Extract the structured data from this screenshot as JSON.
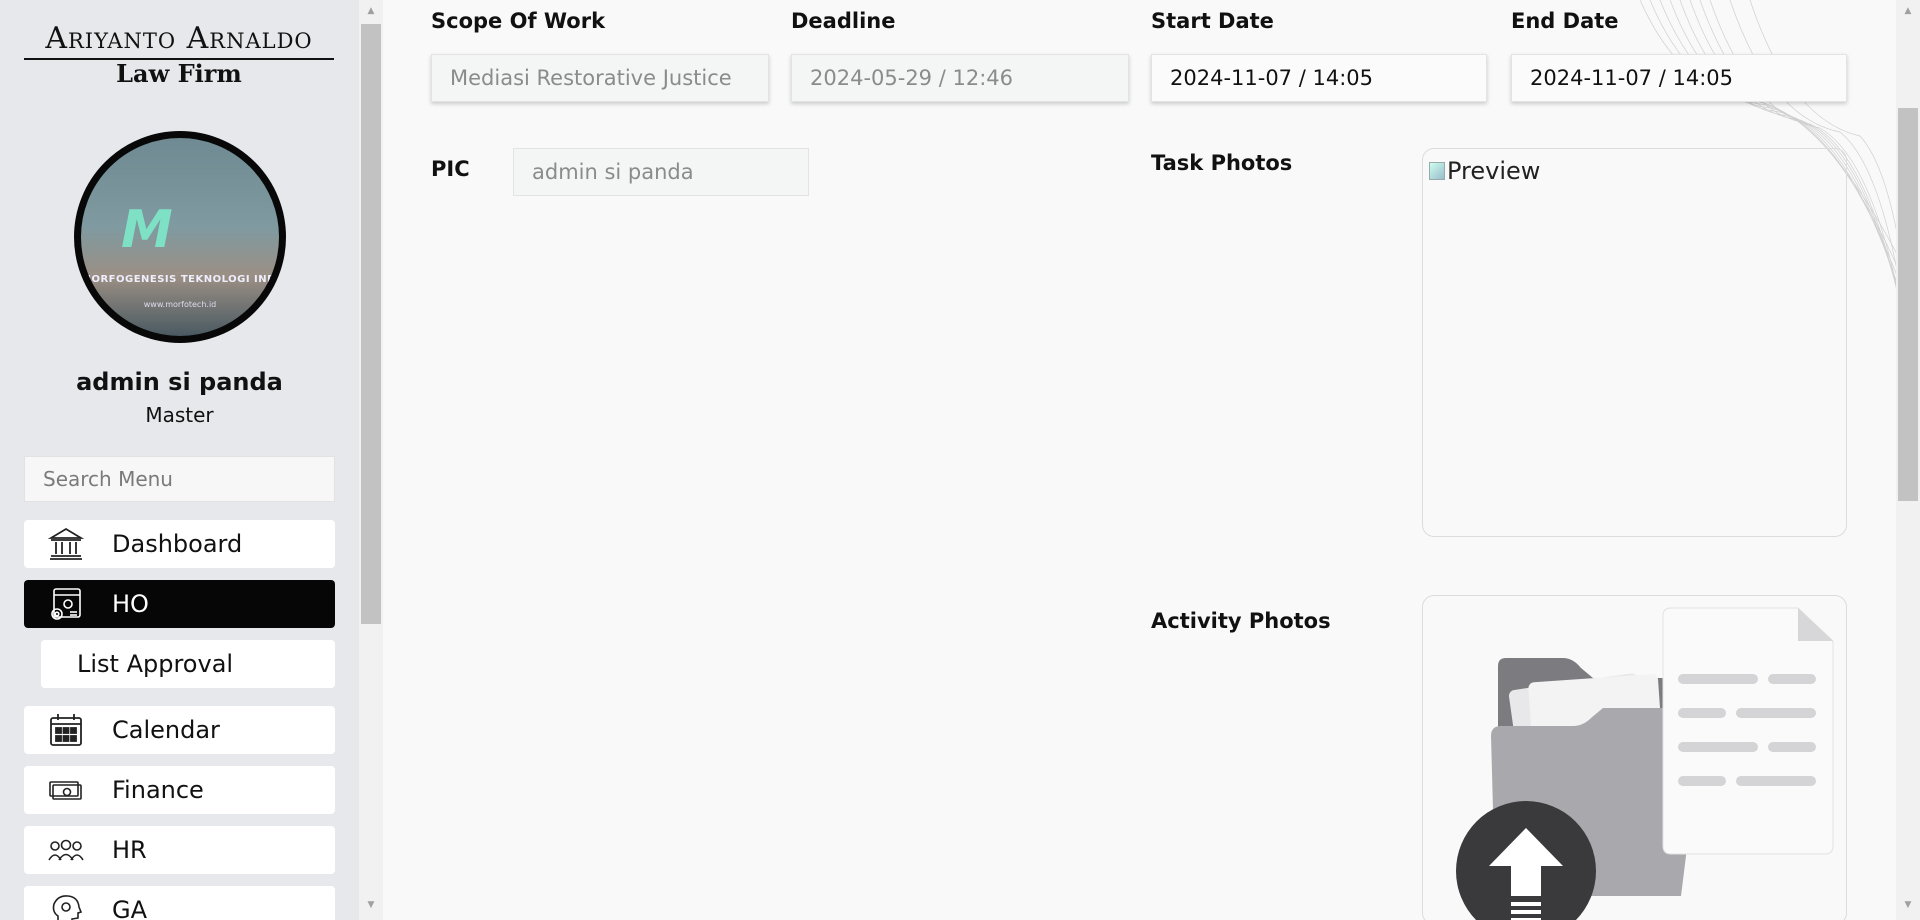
{
  "logo": {
    "name": "Ariyanto Arnaldo",
    "sub": "Law Firm"
  },
  "avatar": {
    "corp_text": "MORFOGENESIS TEKNOLOGI INDO",
    "url_text": "www.morfotech.id"
  },
  "user": {
    "name": "admin si panda",
    "role": "Master"
  },
  "search": {
    "placeholder": "Search Menu"
  },
  "menu": {
    "dashboard": "Dashboard",
    "ho": "HO",
    "list_approval": "List Approval",
    "calendar": "Calendar",
    "finance": "Finance",
    "hr": "HR",
    "ga": "GA"
  },
  "form": {
    "scope_of_work": {
      "label": "Scope Of Work",
      "value": "Mediasi Restorative Justice"
    },
    "deadline": {
      "label": "Deadline",
      "value": "2024-05-29 / 12:46"
    },
    "start_date": {
      "label": "Start Date",
      "value": "2024-11-07 / 14:05"
    },
    "end_date": {
      "label": "End Date",
      "value": "2024-11-07 / 14:05"
    },
    "pic": {
      "label": "PIC",
      "value": "admin si panda"
    },
    "task_photos": {
      "label": "Task Photos",
      "alt": "Preview"
    },
    "activity_photos": {
      "label": "Activity Photos"
    }
  },
  "colors": {
    "active_menu_bg": "#060606",
    "sidebar_bg": "#e6e8ec",
    "page_bg": "#f8f9f8"
  }
}
